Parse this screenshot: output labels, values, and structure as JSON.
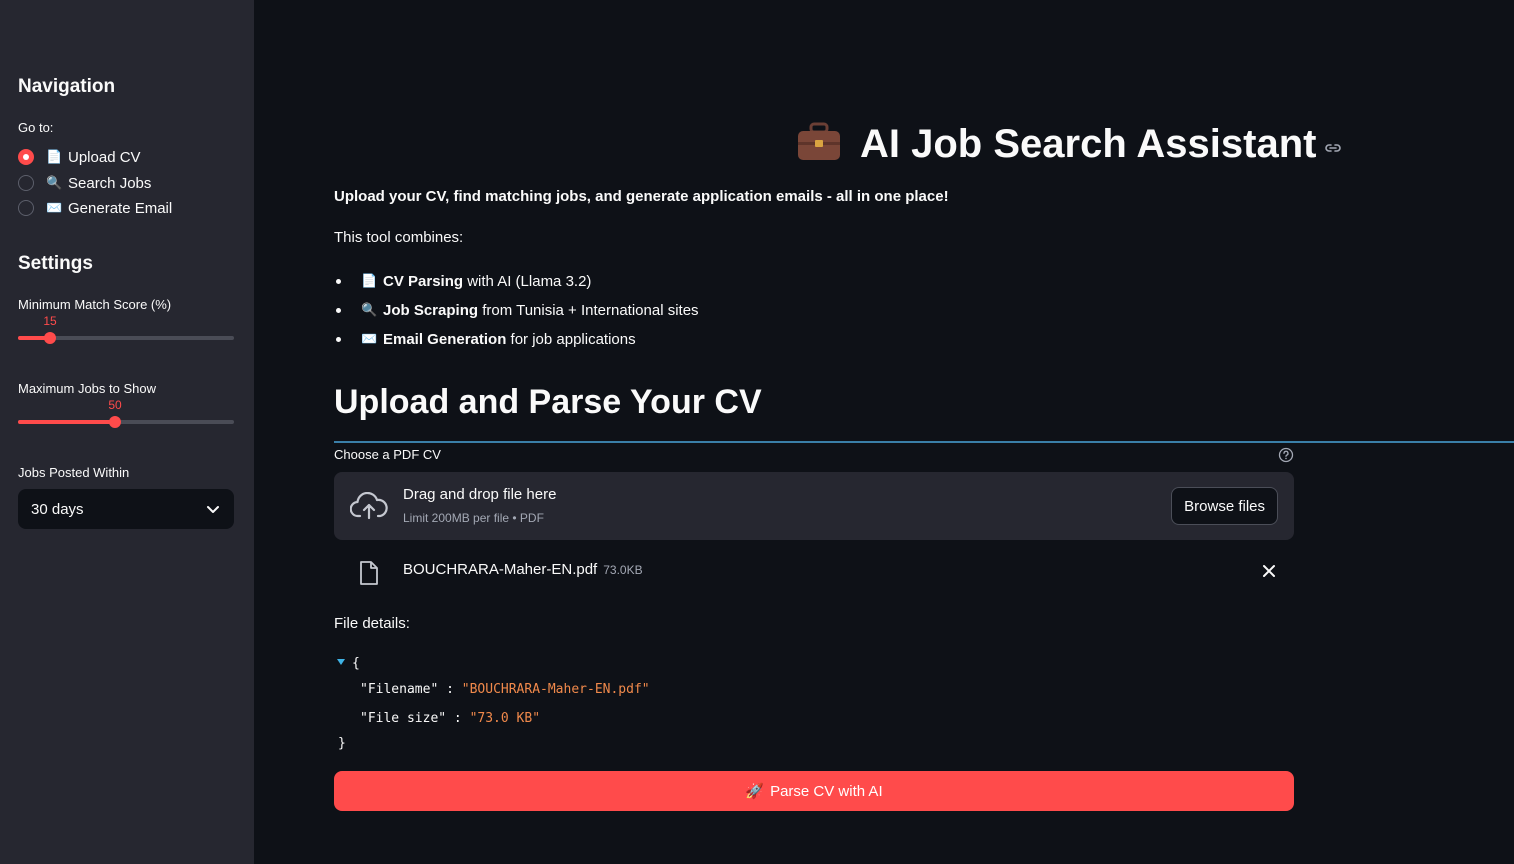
{
  "sidebar": {
    "nav_heading": "Navigation",
    "goto_label": "Go to:",
    "nav_options": [
      {
        "emoji": "📄",
        "label": "Upload CV",
        "selected": true
      },
      {
        "emoji": "🔍",
        "label": "Search Jobs",
        "selected": false
      },
      {
        "emoji": "✉️",
        "label": "Generate Email",
        "selected": false
      }
    ],
    "settings_heading": "Settings",
    "min_match": {
      "label": "Minimum Match Score (%)",
      "value": "15",
      "fraction": 0.15
    },
    "max_jobs": {
      "label": "Maximum Jobs to Show",
      "value": "50",
      "fraction": 0.45
    },
    "posted_within": {
      "label": "Jobs Posted Within",
      "value": "30 days"
    }
  },
  "main": {
    "title_emoji": "💼",
    "title": "AI Job Search Assistant",
    "intro": "Upload your CV, find matching jobs, and generate application emails - all in one place!",
    "combines_label": "This tool combines:",
    "features": [
      {
        "emoji": "📄",
        "bold": "CV Parsing",
        "rest": " with AI (Llama 3.2)"
      },
      {
        "emoji": "🔍",
        "bold": "Job Scraping",
        "rest": " from Tunisia + International sites"
      },
      {
        "emoji": "✉️",
        "bold": "Email Generation",
        "rest": " for job applications"
      }
    ],
    "section_heading": "Upload and Parse Your CV",
    "uploader": {
      "label": "Choose a PDF CV",
      "drag_text": "Drag and drop file here",
      "limit_text": "Limit 200MB per file • PDF",
      "browse_label": "Browse files",
      "file_name": "BOUCHRARA-Maher-EN.pdf",
      "file_size": "73.0KB"
    },
    "file_details_label": "File details:",
    "json_view": {
      "open_brace": "{",
      "close_brace": "}",
      "rows": [
        {
          "key": "\"Filename\"",
          "sep": " : ",
          "value": "\"BOUCHRARA-Maher-EN.pdf\""
        },
        {
          "key": "\"File size\"",
          "sep": " : ",
          "value": "\"73.0 KB\""
        }
      ]
    },
    "parse_button": {
      "emoji": "🚀",
      "label": "Parse CV with AI"
    }
  },
  "colors": {
    "accent": "#ff4b4b",
    "sidebar_bg": "#262730",
    "main_bg": "#0e1117",
    "json_string": "#f0894b"
  }
}
